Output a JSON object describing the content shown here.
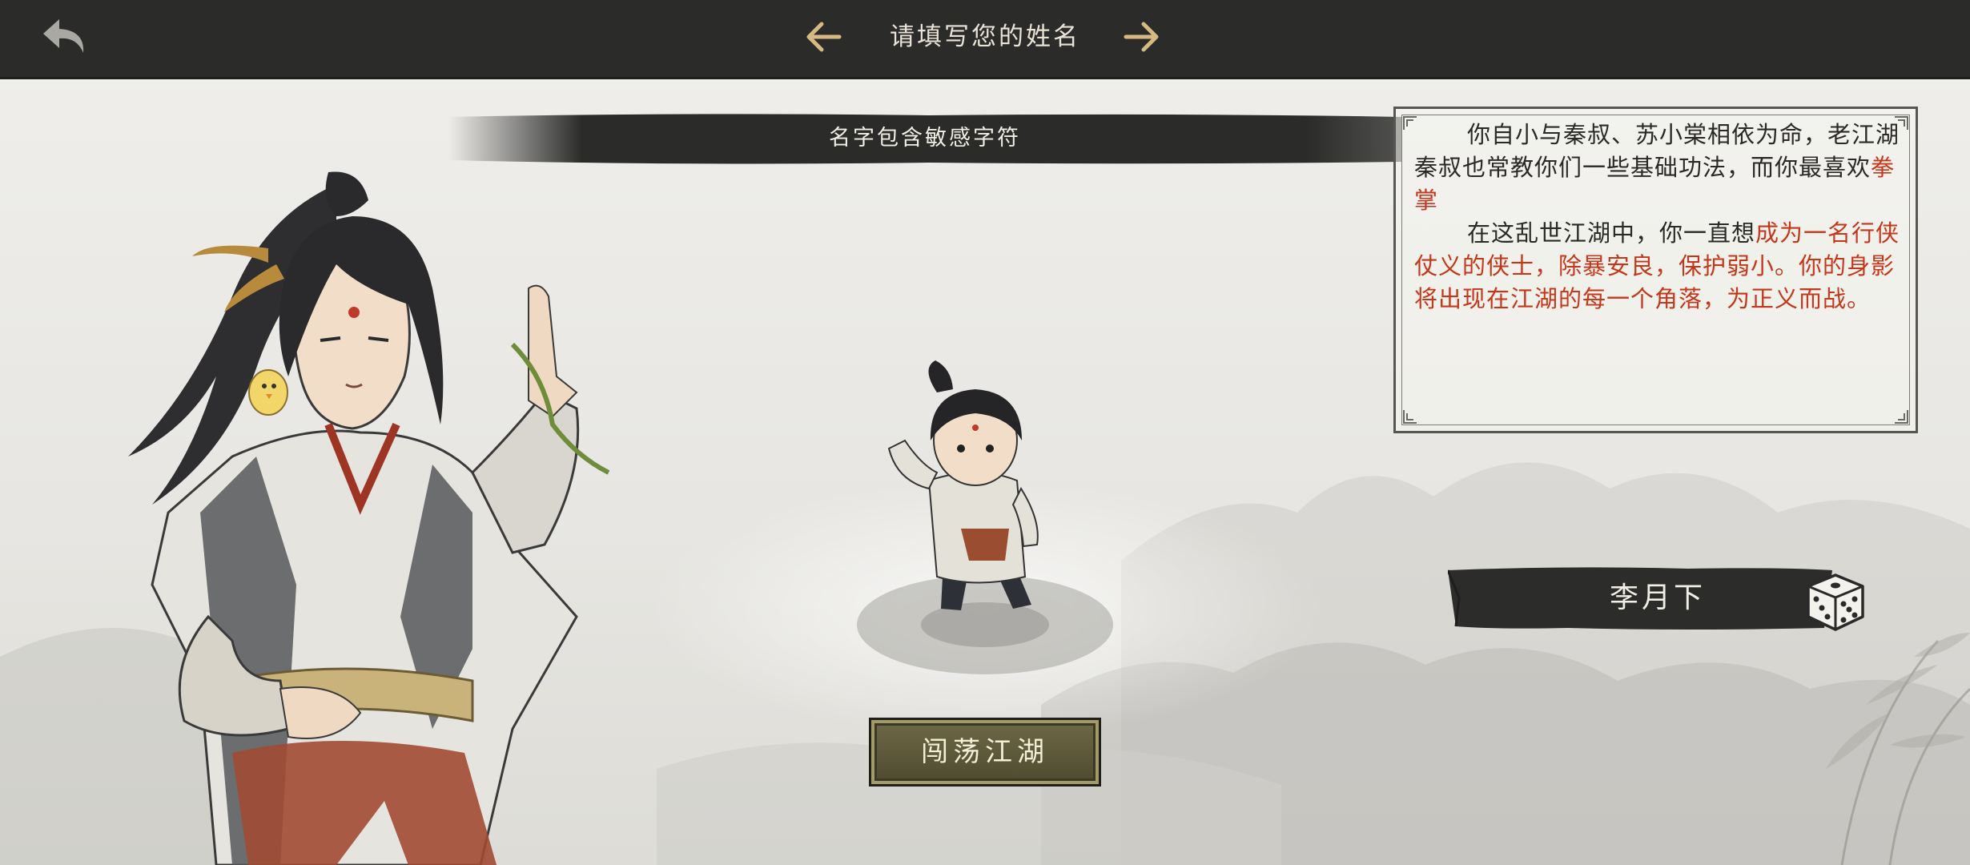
{
  "header": {
    "title": "请填写您的姓名",
    "back_icon": "back-arrow-icon",
    "prev_icon": "arrow-left-icon",
    "next_icon": "arrow-right-icon"
  },
  "banner": {
    "message": "名字包含敏感字符"
  },
  "story": {
    "line1_prefix": "你自小与秦叔、苏小棠相依为命，老江湖秦叔也常教你们一些基础功法，而你最喜欢",
    "line1_highlight": "拳掌",
    "line2_prefix": "在这乱世江湖中，你一直想",
    "line2_highlight": "成为一名行侠仗义的侠士，除暴安良，保护弱小。你的身影将出现在江湖的每一个角落，为正义而战。"
  },
  "name_field": {
    "value": "李月下",
    "dice_icon": "dice-icon"
  },
  "actions": {
    "enter_label": "闯荡江湖"
  },
  "colors": {
    "highlight": "#c5361a",
    "topbar": "#2b2b2a",
    "button": "#5d5838"
  }
}
